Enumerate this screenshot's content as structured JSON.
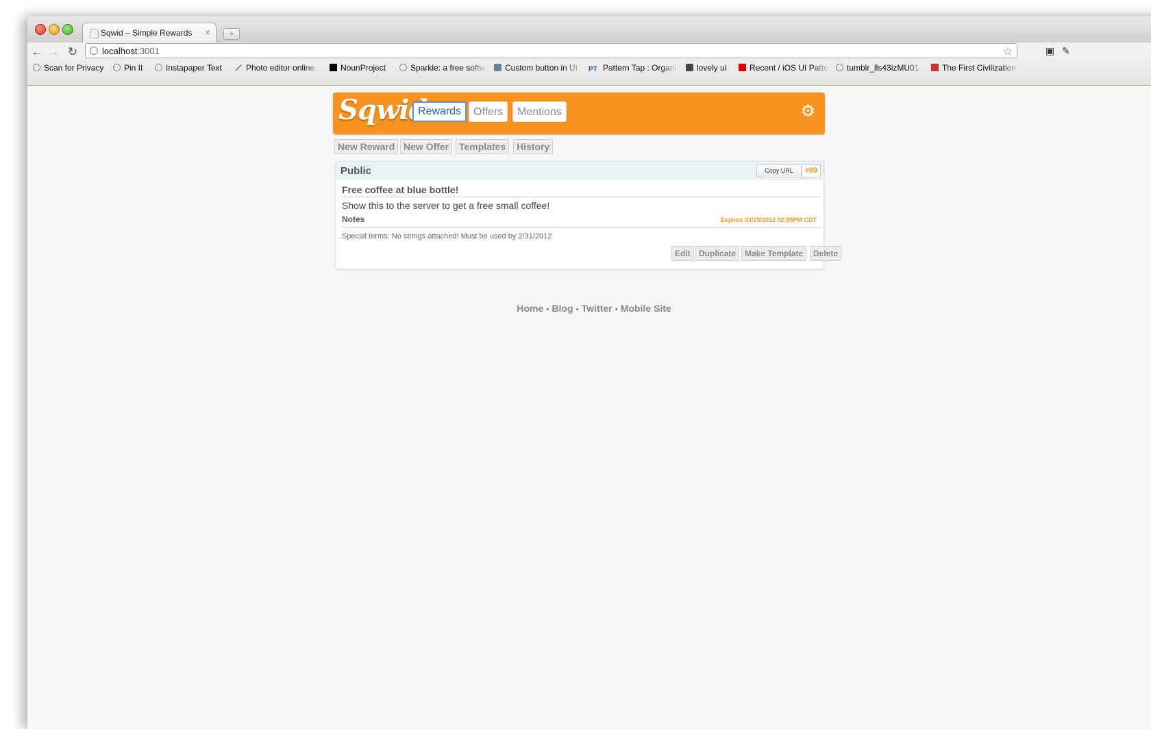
{
  "browser": {
    "tab_title": "Sqwid – Simple Rewards",
    "url_host": "localhost",
    "url_port": ":3001",
    "bookmarks": [
      "Scan for Privacy",
      "Pin It",
      "Instapaper Text",
      "Photo editor online",
      "NounProject",
      "Sparkle: a free softw",
      "Custom button in UI",
      "Pattern Tap : Organi",
      "lovely ui",
      "Recent / iOS UI Patte",
      "tumblr_lls43izMU01",
      "The First Civilization"
    ]
  },
  "app": {
    "logo": "Sqwid",
    "brand_color": "#f7931e",
    "nav": [
      "Rewards",
      "Offers",
      "Mentions"
    ],
    "active_nav": "Rewards",
    "subnav": [
      "New Reward",
      "New Offer",
      "Templates",
      "History"
    ]
  },
  "reward": {
    "visibility": "Public",
    "copy_url_label": "Copy URL",
    "id": "#89",
    "title": "Free coffee at blue bottle!",
    "description": "Show this to the server to get a free small coffee!",
    "notes_label": "Notes",
    "expires": "Expires 03/15/2012 02:55PM CDT",
    "terms": "Special terms: No strings attached! Must be used by 2/31/2012",
    "actions": [
      "Edit",
      "Duplicate",
      "Make Template",
      "Delete"
    ]
  },
  "footer": {
    "links": [
      "Home",
      "Blog",
      "Twitter",
      "Mobile Site"
    ],
    "separator": "•"
  }
}
